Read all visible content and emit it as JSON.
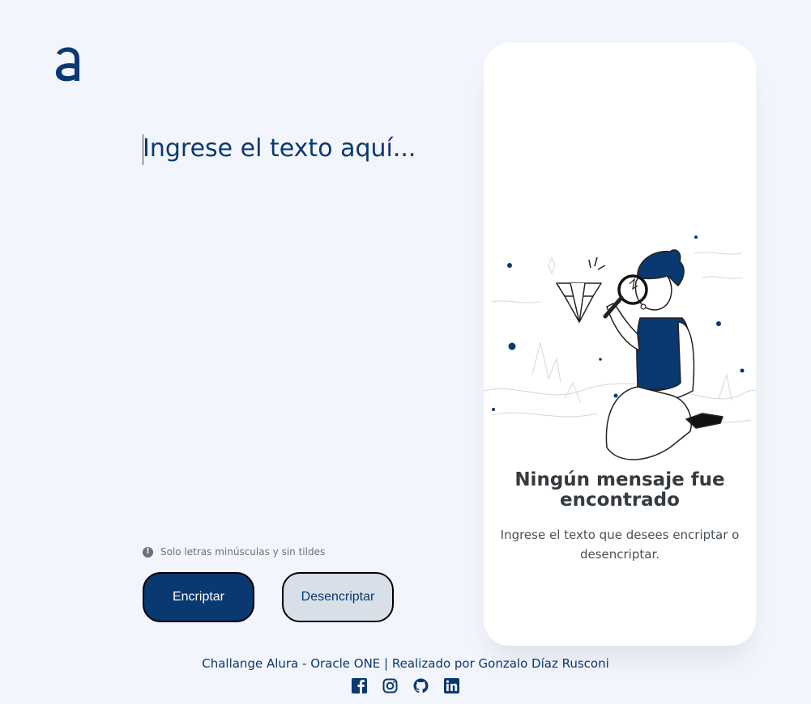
{
  "input": {
    "placeholder": "Ingrese el texto aquí..."
  },
  "hint": {
    "icon": "info-icon",
    "text": "Solo letras minúsculas y sin tildes"
  },
  "buttons": {
    "encrypt": "Encriptar",
    "decrypt": "Desencriptar"
  },
  "output": {
    "title": "Ningún mensaje fue encontrado",
    "message": "Ingrese el texto que desees encriptar o desencriptar."
  },
  "footer": {
    "credit": "Challange Alura - Oracle ONE | Realizado por Gonzalo Díaz Rusconi",
    "social": [
      "facebook-icon",
      "instagram-icon",
      "github-icon",
      "linkedin-icon"
    ]
  },
  "colors": {
    "background": "#f3f5fc",
    "primary": "#0a3871",
    "secondary_button": "#d8dfe8",
    "panel": "#ffffff"
  }
}
